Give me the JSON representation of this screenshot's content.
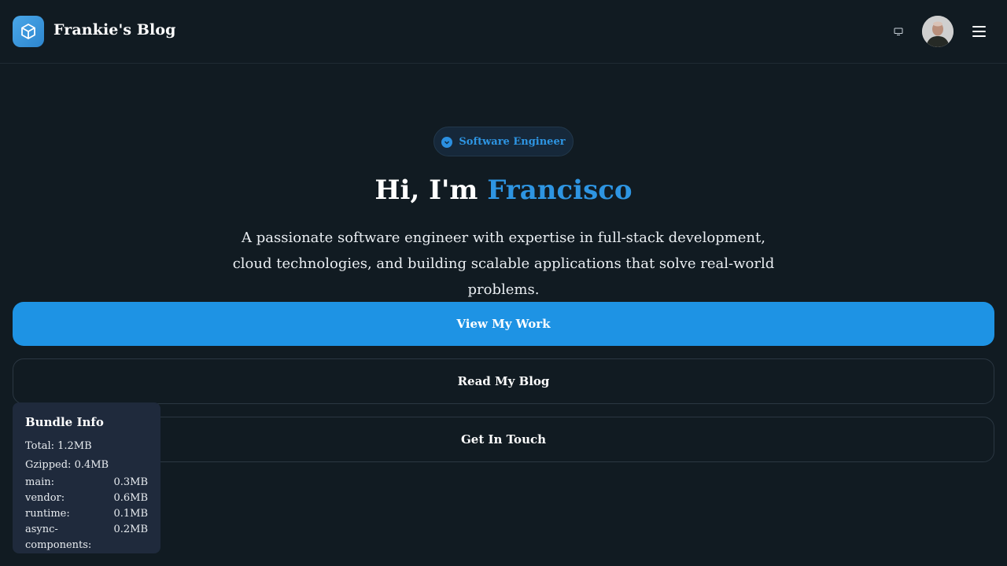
{
  "header": {
    "logo_icon": "cube-icon",
    "site_title": "Frankie's Blog",
    "theme_toggle_icon": "monitor-icon",
    "menu_icon": "hamburger-icon"
  },
  "hero": {
    "badge_label": "Software Engineer",
    "title_prefix": "Hi, I'm ",
    "title_name": "Francisco",
    "description": "A passionate software engineer with expertise in full-stack development, cloud technologies, and building scalable applications that solve real-world problems."
  },
  "actions": {
    "primary": "View My Work",
    "blog": "Read My Blog",
    "contact": "Get In Touch"
  },
  "bundle_info": {
    "title": "Bundle Info",
    "total": "Total: 1.2MB",
    "gzipped": "Gzipped: 0.4MB",
    "chunks": [
      {
        "name": "main:",
        "size": "0.3MB"
      },
      {
        "name": "vendor:",
        "size": "0.6MB"
      },
      {
        "name": "runtime:",
        "size": "0.1MB"
      },
      {
        "name": "async-components:",
        "size": "0.2MB"
      }
    ]
  },
  "colors": {
    "background": "#111b22",
    "accent": "#1e93e4",
    "panel": "#1f2a3c"
  }
}
